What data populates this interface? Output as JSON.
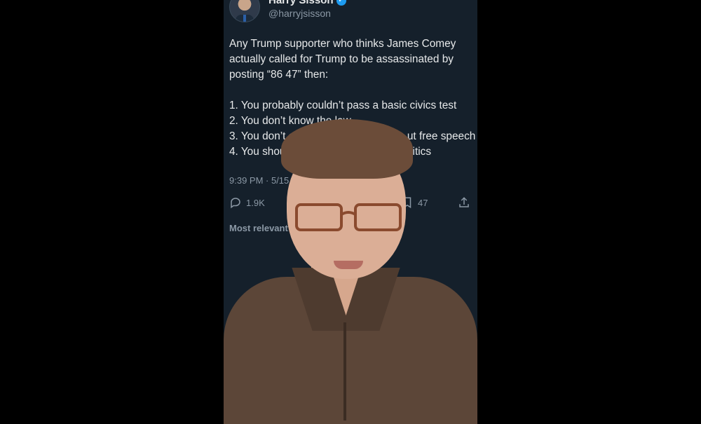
{
  "tweet": {
    "author_name": "Harry Sisson",
    "author_handle": "@harryjsisson",
    "intro_line_1": "Any Trump supporter who thinks James Comey",
    "intro_line_2": "actually called for Trump to be assassinated by",
    "intro_line_3": "posting “86 47” then:",
    "list": [
      "1. You probably couldn’t pass a basic civics test",
      "2. You don’t know the law",
      "3. You don’t act",
      "ut free speech",
      "4. You should",
      "politics"
    ],
    "timestamp": "9:39 PM · 5/15",
    "reply_count": "1.9K",
    "bookmark_count": "47",
    "most_relevant": "Most relevant"
  },
  "icons": {
    "reply": "reply-icon",
    "bookmark": "bookmark-icon",
    "share": "share-icon",
    "verified": "verified-badge-icon"
  },
  "colors": {
    "background": "#000000",
    "tweet_background": "#15202b",
    "primary_text": "#e7e9ea",
    "secondary_text": "#8b98a5",
    "verified": "#1d9bf0"
  }
}
